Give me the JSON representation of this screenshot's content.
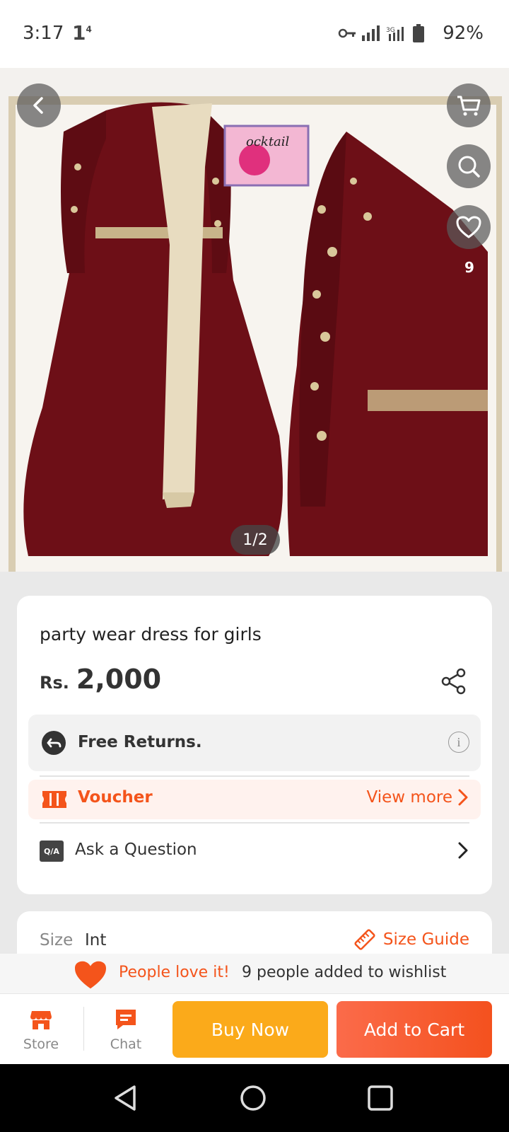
{
  "status_bar": {
    "time": "3:17",
    "sim_indicator": "1",
    "battery_percent": "92%"
  },
  "gallery": {
    "counter": "1/2",
    "wishlist_count": "9"
  },
  "product": {
    "title": "party wear dress for girls",
    "currency": "Rs.",
    "price": "2,000"
  },
  "returns": {
    "label": "Free Returns."
  },
  "voucher": {
    "label": "Voucher",
    "view_more": "View more"
  },
  "qa": {
    "icon_text": "Q/A",
    "label": "Ask a Question"
  },
  "size": {
    "label": "Size",
    "value": "Int",
    "guide": "Size Guide"
  },
  "wishlist_banner": {
    "love_text": "People love it!",
    "added_text": "9 people added to wishlist"
  },
  "bottom_bar": {
    "store_label": "Store",
    "chat_label": "Chat",
    "buy_now": "Buy Now",
    "add_to_cart": "Add to Cart"
  },
  "colors": {
    "accent": "#f4541b",
    "buy_now": "#fbaa1a",
    "dress": "#6d0f17"
  },
  "icons": [
    "back-arrow-icon",
    "cart-icon",
    "search-icon",
    "heart-icon",
    "share-icon",
    "returns-icon",
    "info-icon",
    "voucher-icon",
    "chevron-right-icon",
    "ruler-icon",
    "store-icon",
    "chat-icon",
    "nav-back-icon",
    "nav-home-icon",
    "nav-recents-icon"
  ]
}
